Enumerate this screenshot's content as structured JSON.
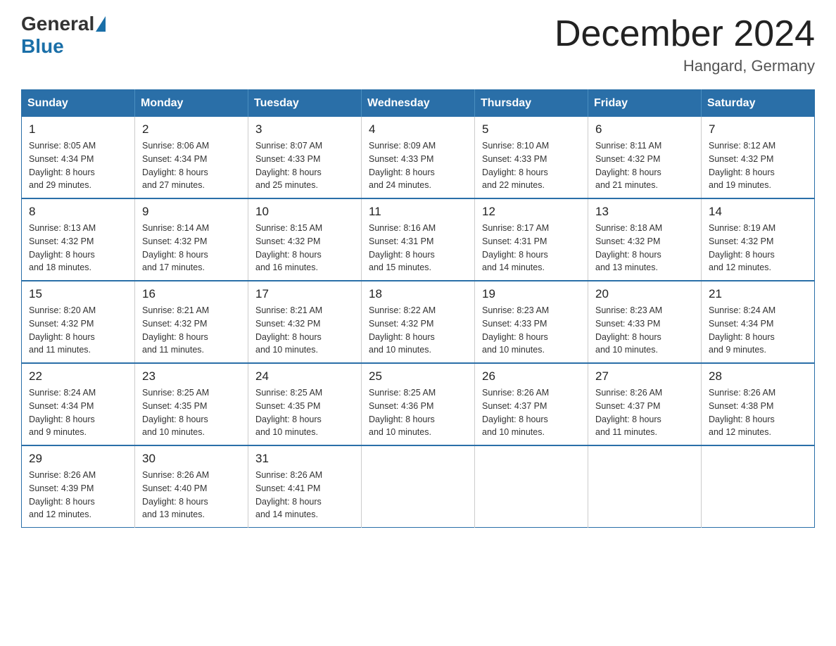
{
  "logo": {
    "general": "General",
    "blue": "Blue"
  },
  "title": {
    "month": "December 2024",
    "location": "Hangard, Germany"
  },
  "header_days": [
    "Sunday",
    "Monday",
    "Tuesday",
    "Wednesday",
    "Thursday",
    "Friday",
    "Saturday"
  ],
  "weeks": [
    [
      {
        "day": "1",
        "sunrise": "8:05 AM",
        "sunset": "4:34 PM",
        "daylight": "8 hours and 29 minutes."
      },
      {
        "day": "2",
        "sunrise": "8:06 AM",
        "sunset": "4:34 PM",
        "daylight": "8 hours and 27 minutes."
      },
      {
        "day": "3",
        "sunrise": "8:07 AM",
        "sunset": "4:33 PM",
        "daylight": "8 hours and 25 minutes."
      },
      {
        "day": "4",
        "sunrise": "8:09 AM",
        "sunset": "4:33 PM",
        "daylight": "8 hours and 24 minutes."
      },
      {
        "day": "5",
        "sunrise": "8:10 AM",
        "sunset": "4:33 PM",
        "daylight": "8 hours and 22 minutes."
      },
      {
        "day": "6",
        "sunrise": "8:11 AM",
        "sunset": "4:32 PM",
        "daylight": "8 hours and 21 minutes."
      },
      {
        "day": "7",
        "sunrise": "8:12 AM",
        "sunset": "4:32 PM",
        "daylight": "8 hours and 19 minutes."
      }
    ],
    [
      {
        "day": "8",
        "sunrise": "8:13 AM",
        "sunset": "4:32 PM",
        "daylight": "8 hours and 18 minutes."
      },
      {
        "day": "9",
        "sunrise": "8:14 AM",
        "sunset": "4:32 PM",
        "daylight": "8 hours and 17 minutes."
      },
      {
        "day": "10",
        "sunrise": "8:15 AM",
        "sunset": "4:32 PM",
        "daylight": "8 hours and 16 minutes."
      },
      {
        "day": "11",
        "sunrise": "8:16 AM",
        "sunset": "4:31 PM",
        "daylight": "8 hours and 15 minutes."
      },
      {
        "day": "12",
        "sunrise": "8:17 AM",
        "sunset": "4:31 PM",
        "daylight": "8 hours and 14 minutes."
      },
      {
        "day": "13",
        "sunrise": "8:18 AM",
        "sunset": "4:32 PM",
        "daylight": "8 hours and 13 minutes."
      },
      {
        "day": "14",
        "sunrise": "8:19 AM",
        "sunset": "4:32 PM",
        "daylight": "8 hours and 12 minutes."
      }
    ],
    [
      {
        "day": "15",
        "sunrise": "8:20 AM",
        "sunset": "4:32 PM",
        "daylight": "8 hours and 11 minutes."
      },
      {
        "day": "16",
        "sunrise": "8:21 AM",
        "sunset": "4:32 PM",
        "daylight": "8 hours and 11 minutes."
      },
      {
        "day": "17",
        "sunrise": "8:21 AM",
        "sunset": "4:32 PM",
        "daylight": "8 hours and 10 minutes."
      },
      {
        "day": "18",
        "sunrise": "8:22 AM",
        "sunset": "4:32 PM",
        "daylight": "8 hours and 10 minutes."
      },
      {
        "day": "19",
        "sunrise": "8:23 AM",
        "sunset": "4:33 PM",
        "daylight": "8 hours and 10 minutes."
      },
      {
        "day": "20",
        "sunrise": "8:23 AM",
        "sunset": "4:33 PM",
        "daylight": "8 hours and 10 minutes."
      },
      {
        "day": "21",
        "sunrise": "8:24 AM",
        "sunset": "4:34 PM",
        "daylight": "8 hours and 9 minutes."
      }
    ],
    [
      {
        "day": "22",
        "sunrise": "8:24 AM",
        "sunset": "4:34 PM",
        "daylight": "8 hours and 9 minutes."
      },
      {
        "day": "23",
        "sunrise": "8:25 AM",
        "sunset": "4:35 PM",
        "daylight": "8 hours and 10 minutes."
      },
      {
        "day": "24",
        "sunrise": "8:25 AM",
        "sunset": "4:35 PM",
        "daylight": "8 hours and 10 minutes."
      },
      {
        "day": "25",
        "sunrise": "8:25 AM",
        "sunset": "4:36 PM",
        "daylight": "8 hours and 10 minutes."
      },
      {
        "day": "26",
        "sunrise": "8:26 AM",
        "sunset": "4:37 PM",
        "daylight": "8 hours and 10 minutes."
      },
      {
        "day": "27",
        "sunrise": "8:26 AM",
        "sunset": "4:37 PM",
        "daylight": "8 hours and 11 minutes."
      },
      {
        "day": "28",
        "sunrise": "8:26 AM",
        "sunset": "4:38 PM",
        "daylight": "8 hours and 12 minutes."
      }
    ],
    [
      {
        "day": "29",
        "sunrise": "8:26 AM",
        "sunset": "4:39 PM",
        "daylight": "8 hours and 12 minutes."
      },
      {
        "day": "30",
        "sunrise": "8:26 AM",
        "sunset": "4:40 PM",
        "daylight": "8 hours and 13 minutes."
      },
      {
        "day": "31",
        "sunrise": "8:26 AM",
        "sunset": "4:41 PM",
        "daylight": "8 hours and 14 minutes."
      },
      null,
      null,
      null,
      null
    ]
  ],
  "labels": {
    "sunrise": "Sunrise:",
    "sunset": "Sunset:",
    "daylight": "Daylight:"
  }
}
